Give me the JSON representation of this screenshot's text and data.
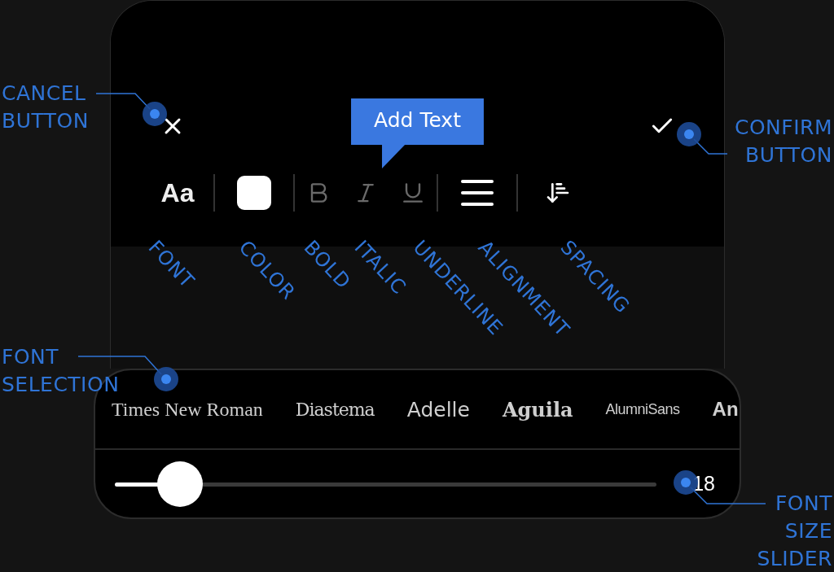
{
  "header": {
    "tooltip": "Add Text"
  },
  "toolbar": [
    {
      "kind": "font",
      "label": "Aa"
    },
    {
      "kind": "color",
      "color": "#ffffff"
    },
    {
      "kind": "bold",
      "disabled": true
    },
    {
      "kind": "italic",
      "disabled": true
    },
    {
      "kind": "underline",
      "disabled": true
    },
    {
      "kind": "align"
    },
    {
      "kind": "spacing"
    }
  ],
  "fonts": [
    {
      "name": "Times New Roman"
    },
    {
      "name": "Diastema"
    },
    {
      "name": "Adelle"
    },
    {
      "name": "Aguila"
    },
    {
      "name": "AlumniSans"
    },
    {
      "name": "An"
    }
  ],
  "size_slider": {
    "level": 0.12,
    "reading": "18"
  },
  "callouts": [
    {
      "text": "CANCEL\nBUTTON"
    },
    {
      "text": "CONFIRM\nBUTTON"
    },
    {
      "text": "FONT\nSELECTION"
    },
    {
      "text": "FONT\nSIZE\nSLIDER"
    }
  ],
  "tool_labels": [
    "FONT",
    "COLOR",
    "BOLD",
    "ITALIC",
    "UNDERLINE",
    "ALIGNMENT",
    "SPACING"
  ]
}
